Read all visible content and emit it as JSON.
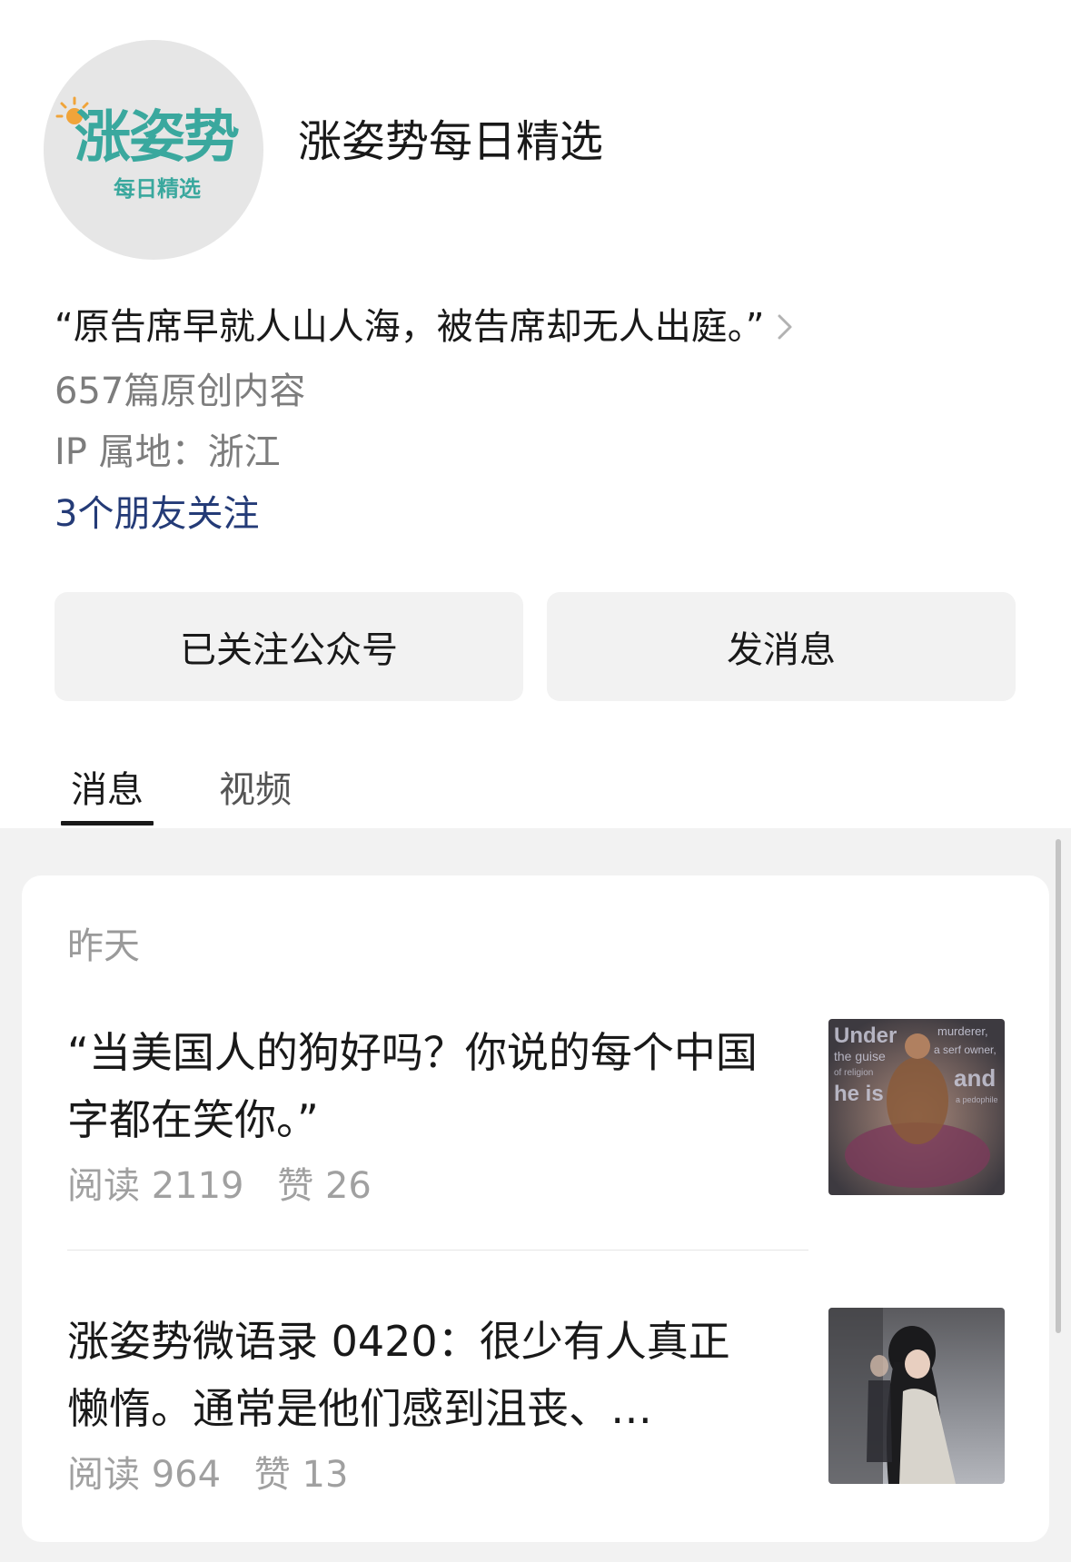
{
  "account": {
    "logo_text": "涨姿势",
    "logo_subtext": "每日精选",
    "name": "涨姿势每日精选",
    "signature": "“原告席早就人山人海，被告席却无人出庭。”",
    "original_count": "657篇原创内容",
    "ip_location": "IP 属地：浙江",
    "friends_following": "3个朋友关注"
  },
  "actions": {
    "follow_label": "已关注公众号",
    "message_label": "发消息"
  },
  "tabs": [
    {
      "label": "消息",
      "active": true
    },
    {
      "label": "视频",
      "active": false
    }
  ],
  "feed": {
    "date_label": "昨天",
    "articles": [
      {
        "title": "“当美国人的狗好吗？你说的每个中国字都在笑你。”",
        "reads": "阅读 2119",
        "likes": "赞 26",
        "thumb_text_1": "Under",
        "thumb_text_2": "murderer,",
        "thumb_text_3": "a serf owner,",
        "thumb_text_4": "the guise",
        "thumb_text_5": "of religion",
        "thumb_text_6": "he is",
        "thumb_text_7": "and",
        "thumb_text_8": "a pedophile"
      },
      {
        "title": "涨姿势微语录 0420：很少有人真正懒惰。通常是他们感到沮丧、…",
        "reads": "阅读 964",
        "likes": "赞 13"
      }
    ]
  },
  "colors": {
    "brand_teal": "#3aa89e",
    "link_blue": "#243b77",
    "button_bg": "#f2f2f2",
    "feed_bg": "#f2f2f2"
  }
}
